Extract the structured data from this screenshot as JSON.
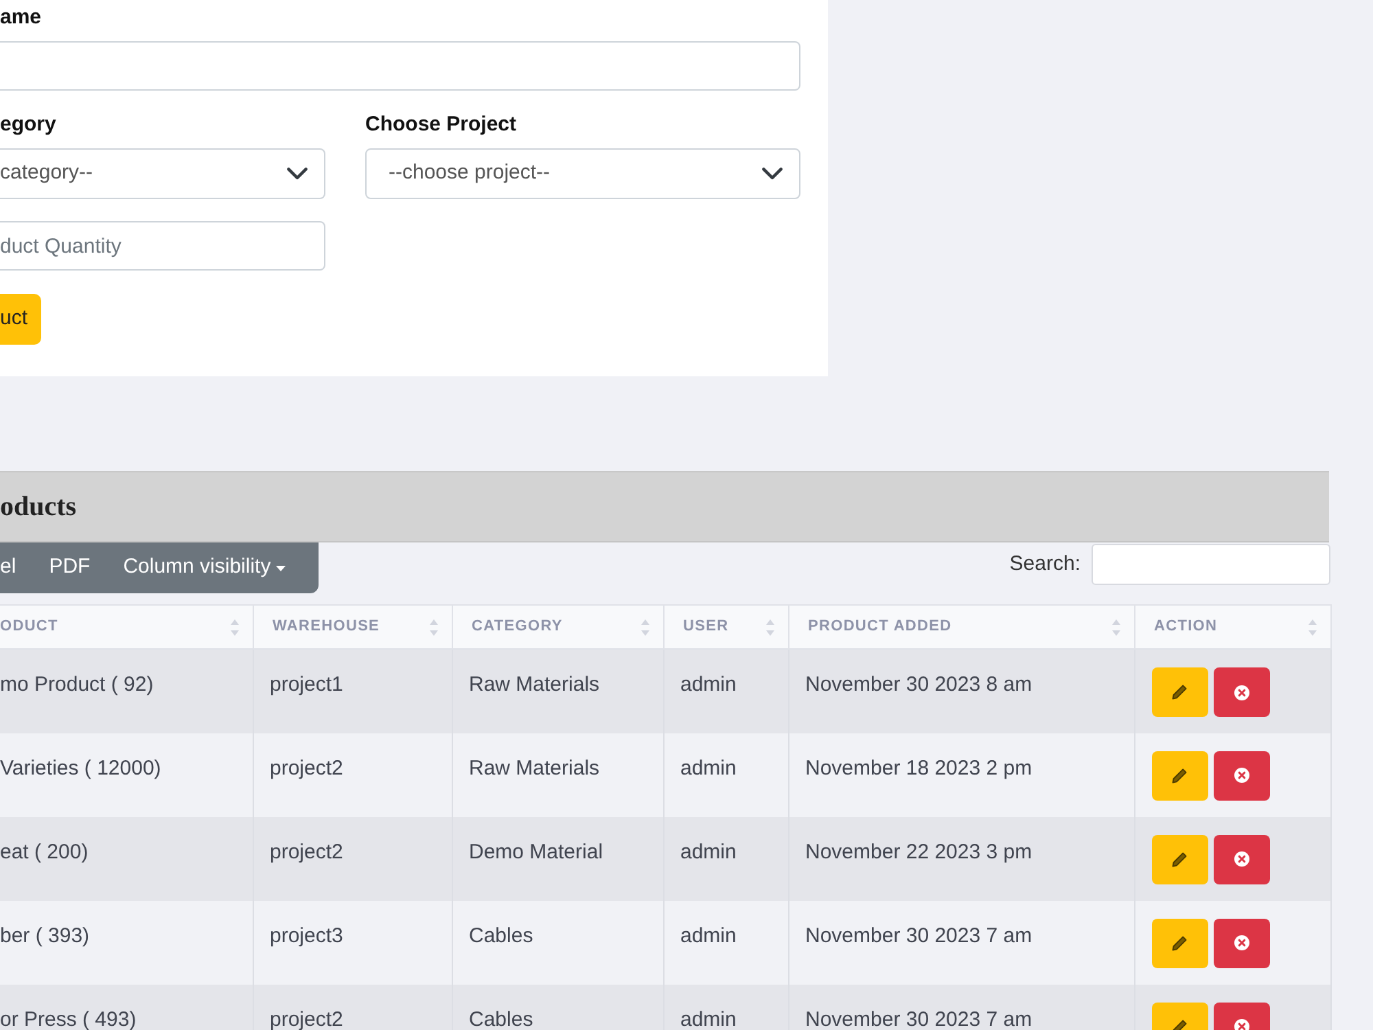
{
  "form": {
    "name": {
      "label": "ame"
    },
    "category": {
      "label": "egory",
      "value": "category--"
    },
    "project": {
      "label": "Choose Project",
      "value": "--choose project--"
    },
    "quantity": {
      "placeholder": "duct Quantity"
    },
    "submit": "uct"
  },
  "products": {
    "title": "oducts",
    "export_buttons": [
      {
        "label": "el",
        "kind": "plain"
      },
      {
        "label": "PDF",
        "kind": "plain"
      },
      {
        "label": "Column visibility",
        "kind": "dropdown"
      }
    ],
    "search": {
      "label": "Search:"
    },
    "table": {
      "columns": [
        "ODUCT",
        "WAREHOUSE",
        "CATEGORY",
        "USER",
        "PRODUCT ADDED",
        "ACTION"
      ],
      "rows": [
        {
          "cells": [
            "mo Product ( 92)",
            "project1",
            "Raw Materials",
            "admin",
            "November 30 2023 8 am"
          ]
        },
        {
          "cells": [
            "Varieties ( 12000)",
            "project2",
            "Raw Materials",
            "admin",
            "November 18 2023 2 pm"
          ]
        },
        {
          "cells": [
            "eat ( 200)",
            "project2",
            "Demo Material",
            "admin",
            "November 22 2023 3 pm"
          ]
        },
        {
          "cells": [
            "ber ( 393)",
            "project3",
            "Cables",
            "admin",
            "November 30 2023 7 am"
          ]
        },
        {
          "cells": [
            "or Press ( 493)",
            "project2",
            "Cables",
            "admin",
            "November 30 2023 7 am"
          ]
        }
      ]
    }
  }
}
